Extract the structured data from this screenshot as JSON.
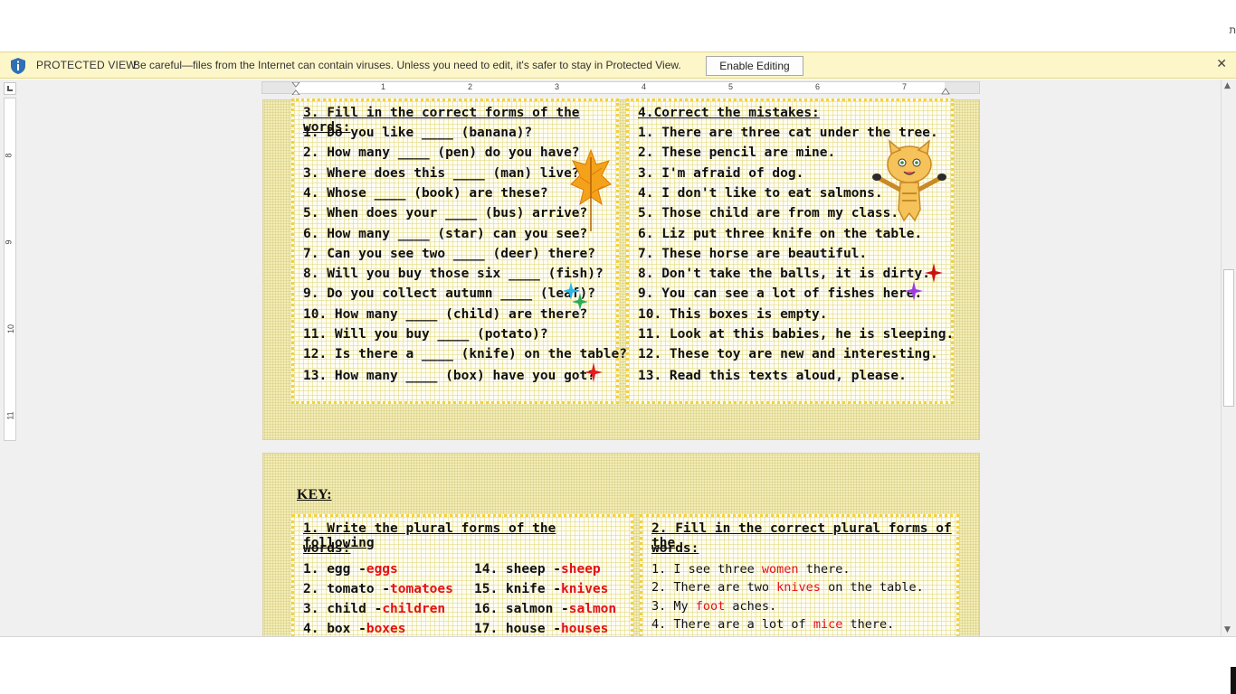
{
  "titlebar": {
    "corner_glyph": "ת"
  },
  "protected_view": {
    "title": "PROTECTED VIEW",
    "message": "Be careful—files from the Internet can contain viruses. Unless you need to edit, it's safer to stay in Protected View.",
    "enable_button": "Enable Editing",
    "close_glyph": "✕"
  },
  "ruler": {
    "horizontal_numbers": [
      "1",
      "2",
      "3",
      "4",
      "5",
      "6",
      "7"
    ],
    "vertical_numbers": [
      "8",
      "9",
      "10",
      "11"
    ]
  },
  "section3": {
    "heading": "3. Fill in the correct forms of the words:",
    "items": [
      "1. Do you like ____ (banana)?",
      "2. How many ____ (pen) do you have?",
      "3. Where does this ____ (man) live?",
      "4. Whose ____ (book) are these?",
      "5. When does your ____ (bus) arrive?",
      "6. How many ____ (star) can you see?",
      "7. Can you see two ____ (deer) there?",
      "8. Will you buy those six ____ (fish)?",
      "9. Do you collect autumn ____ (leaf)?",
      "10. How many ____ (child) are there?",
      "11. Will you buy ____ (potato)?",
      "12. Is there a ____ (knife) on the table?",
      "13. How many ____ (box) have you got?"
    ]
  },
  "section4": {
    "heading": "4.Correct the mistakes:",
    "items": [
      "1. There are three cat under the tree.",
      "2. These pencil are mine.",
      "3. I'm afraid of dog.",
      "4. I don't like to eat salmons.",
      "5. Those child are from my class.",
      "6. Liz put three knife on the table.",
      "7. These horse are beautiful.",
      "8. Don't take the balls, it is dirty.",
      "9. You can see a lot of fishes here.",
      "10. This boxes is empty.",
      "11. Look at this babies, he is sleeping.",
      "12. These toy are new and interesting.",
      "13. Read this texts aloud, please."
    ]
  },
  "key": {
    "title": "KEY:",
    "section1": {
      "heading_line1": "1. Write the plural forms of the following",
      "heading_line2": "words:",
      "left": [
        {
          "word": "1. egg -",
          "answer": "eggs"
        },
        {
          "word": "2. tomato -",
          "answer": "tomatoes"
        },
        {
          "word": "3. child -",
          "answer": "children"
        },
        {
          "word": "4. box -",
          "answer": "boxes"
        }
      ],
      "right": [
        {
          "word": "14. sheep -",
          "answer": "sheep"
        },
        {
          "word": "15. knife -",
          "answer": "knives"
        },
        {
          "word": "16. salmon -",
          "answer": "salmon"
        },
        {
          "word": "17. house -",
          "answer": "houses"
        }
      ]
    },
    "section2": {
      "heading_line1": "2. Fill in the correct plural forms of the",
      "heading_line2": "words:",
      "items": [
        {
          "before": "1. I see three ",
          "answer": "women",
          "after": " there."
        },
        {
          "before": "2. There are two ",
          "answer": "knives",
          "after": " on the table."
        },
        {
          "before": "3. My ",
          "answer": "foot",
          "after": " aches."
        },
        {
          "before": "4. There are a lot of ",
          "answer": "mice",
          "after": " there."
        }
      ]
    }
  },
  "colors": {
    "answer_red": "#e31212",
    "infobar_bg": "#fcf6c9",
    "page_bg": "#f2ecb4",
    "box_border": "#f3d23c"
  },
  "icons": [
    "info-shield-icon",
    "close-icon",
    "ruler-tab-icon",
    "autumn-leaf-icon",
    "cat-icon",
    "sparkle-icon"
  ]
}
